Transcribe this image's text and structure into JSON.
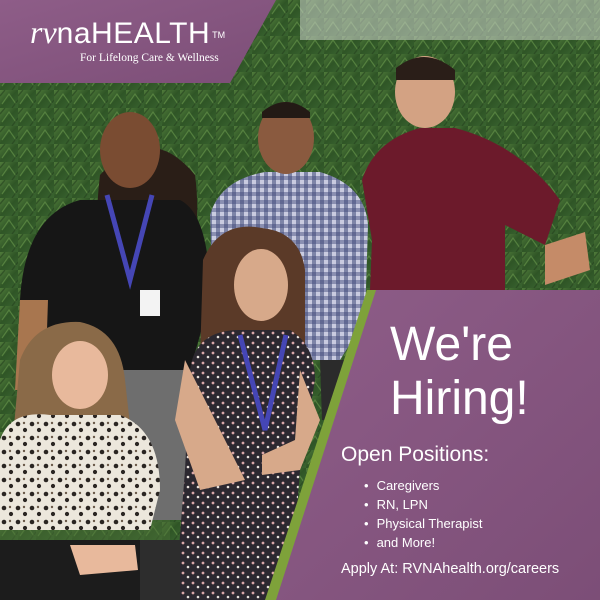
{
  "brand": {
    "logo_text": "rvnaHEALTH",
    "logo_rv": "rv",
    "logo_rest": "naHEALTH",
    "trademark": "TM",
    "tagline": "For Lifelong Care & Wellness"
  },
  "headline": {
    "line1": "We're",
    "line2": "Hiring!"
  },
  "positions": {
    "title": "Open Positions:",
    "items": [
      "Caregivers",
      "RN, LPN",
      "Physical Therapist",
      "and More!"
    ]
  },
  "apply": "Apply At: RVNAhealth.org/careers",
  "colors": {
    "purple": "#8a5a84",
    "purple_dark": "#7d4f78",
    "green_accent": "#7ea23a",
    "foliage": "#3f6a2c",
    "white": "#ffffff"
  }
}
